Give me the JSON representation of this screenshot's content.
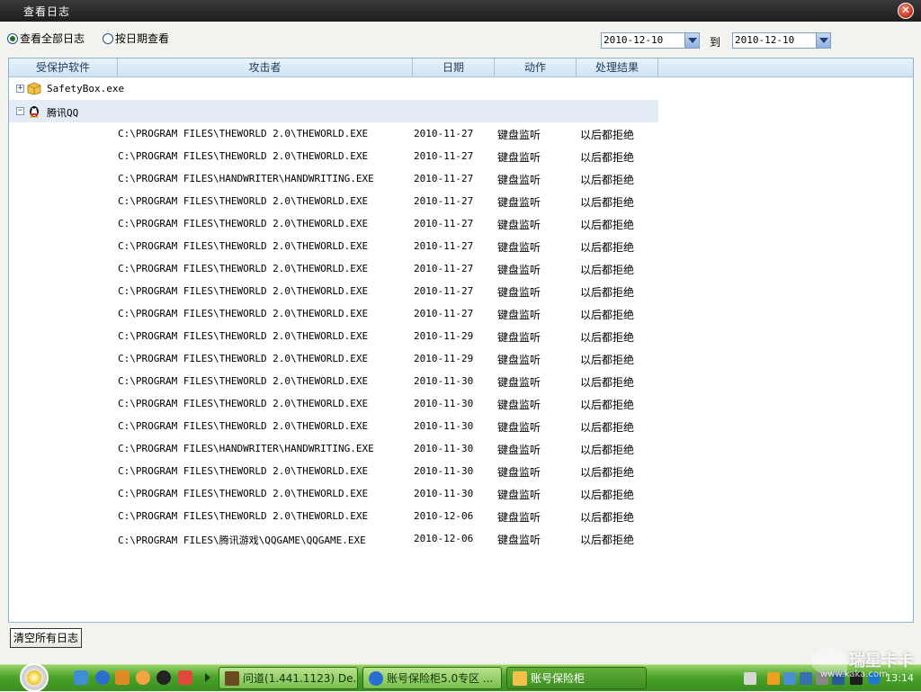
{
  "window": {
    "title": "查看日志",
    "close_label": "✕"
  },
  "filter": {
    "radio_all": "查看全部日志",
    "radio_date": "按日期查看",
    "selected": "all",
    "date_from": "2010-12-10",
    "to_label": "到",
    "date_to": "2010-12-10"
  },
  "grid": {
    "columns": [
      "受保护软件",
      "攻击者",
      "日期",
      "动作",
      "处理结果"
    ],
    "groups": [
      {
        "name": "SafetyBox.exe",
        "expanded": false,
        "toggle": "+",
        "icon": "folder-box-icon"
      },
      {
        "name": "腾讯QQ",
        "expanded": true,
        "toggle": "−",
        "icon": "qq-penguin-icon"
      }
    ],
    "rows": [
      {
        "path": "C:\\PROGRAM FILES\\THEWORLD 2.0\\THEWORLD.EXE",
        "date": "2010-11-27",
        "action": "键盘监听",
        "result": "以后都拒绝"
      },
      {
        "path": "C:\\PROGRAM FILES\\THEWORLD 2.0\\THEWORLD.EXE",
        "date": "2010-11-27",
        "action": "键盘监听",
        "result": "以后都拒绝"
      },
      {
        "path": "C:\\PROGRAM FILES\\HANDWRITER\\HANDWRITING.EXE",
        "date": "2010-11-27",
        "action": "键盘监听",
        "result": "以后都拒绝"
      },
      {
        "path": "C:\\PROGRAM FILES\\THEWORLD 2.0\\THEWORLD.EXE",
        "date": "2010-11-27",
        "action": "键盘监听",
        "result": "以后都拒绝"
      },
      {
        "path": "C:\\PROGRAM FILES\\THEWORLD 2.0\\THEWORLD.EXE",
        "date": "2010-11-27",
        "action": "键盘监听",
        "result": "以后都拒绝"
      },
      {
        "path": "C:\\PROGRAM FILES\\THEWORLD 2.0\\THEWORLD.EXE",
        "date": "2010-11-27",
        "action": "键盘监听",
        "result": "以后都拒绝"
      },
      {
        "path": "C:\\PROGRAM FILES\\THEWORLD 2.0\\THEWORLD.EXE",
        "date": "2010-11-27",
        "action": "键盘监听",
        "result": "以后都拒绝"
      },
      {
        "path": "C:\\PROGRAM FILES\\THEWORLD 2.0\\THEWORLD.EXE",
        "date": "2010-11-27",
        "action": "键盘监听",
        "result": "以后都拒绝"
      },
      {
        "path": "C:\\PROGRAM FILES\\THEWORLD 2.0\\THEWORLD.EXE",
        "date": "2010-11-27",
        "action": "键盘监听",
        "result": "以后都拒绝"
      },
      {
        "path": "C:\\PROGRAM FILES\\THEWORLD 2.0\\THEWORLD.EXE",
        "date": "2010-11-29",
        "action": "键盘监听",
        "result": "以后都拒绝"
      },
      {
        "path": "C:\\PROGRAM FILES\\THEWORLD 2.0\\THEWORLD.EXE",
        "date": "2010-11-29",
        "action": "键盘监听",
        "result": "以后都拒绝"
      },
      {
        "path": "C:\\PROGRAM FILES\\THEWORLD 2.0\\THEWORLD.EXE",
        "date": "2010-11-30",
        "action": "键盘监听",
        "result": "以后都拒绝"
      },
      {
        "path": "C:\\PROGRAM FILES\\THEWORLD 2.0\\THEWORLD.EXE",
        "date": "2010-11-30",
        "action": "键盘监听",
        "result": "以后都拒绝"
      },
      {
        "path": "C:\\PROGRAM FILES\\THEWORLD 2.0\\THEWORLD.EXE",
        "date": "2010-11-30",
        "action": "键盘监听",
        "result": "以后都拒绝"
      },
      {
        "path": "C:\\PROGRAM FILES\\HANDWRITER\\HANDWRITING.EXE",
        "date": "2010-11-30",
        "action": "键盘监听",
        "result": "以后都拒绝"
      },
      {
        "path": "C:\\PROGRAM FILES\\THEWORLD 2.0\\THEWORLD.EXE",
        "date": "2010-11-30",
        "action": "键盘监听",
        "result": "以后都拒绝"
      },
      {
        "path": "C:\\PROGRAM FILES\\THEWORLD 2.0\\THEWORLD.EXE",
        "date": "2010-11-30",
        "action": "键盘监听",
        "result": "以后都拒绝"
      },
      {
        "path": "C:\\PROGRAM FILES\\THEWORLD 2.0\\THEWORLD.EXE",
        "date": "2010-12-06",
        "action": "键盘监听",
        "result": "以后都拒绝"
      },
      {
        "path": "C:\\PROGRAM FILES\\腾讯游戏\\QQGAME\\QQGAME.EXE",
        "date": "2010-12-06",
        "action": "键盘监听",
        "result": "以后都拒绝"
      }
    ]
  },
  "buttons": {
    "clear_all": "清空所有日志"
  },
  "taskbar": {
    "quick_launch": [
      "show-desktop-icon",
      "ie-icon",
      "game-icon",
      "face-icon",
      "qq-icon",
      "doc-icon"
    ],
    "tasks": [
      {
        "label": "问道(1.441.1123) De...",
        "icon": "game-app-icon",
        "active": false
      },
      {
        "label": "账号保险柜5.0专区 ...",
        "icon": "ie-icon",
        "active": false
      },
      {
        "label": "账号保险柜",
        "icon": "safe-box-icon",
        "active": true
      }
    ],
    "clock": "13:14"
  },
  "watermark": {
    "main": "瑞星卡卡",
    "sub": "www.kaka.com"
  },
  "colors": {
    "accent": "#3a8f20",
    "header_bg": "#cfe3f3",
    "selected_row": "#e4edf6"
  }
}
